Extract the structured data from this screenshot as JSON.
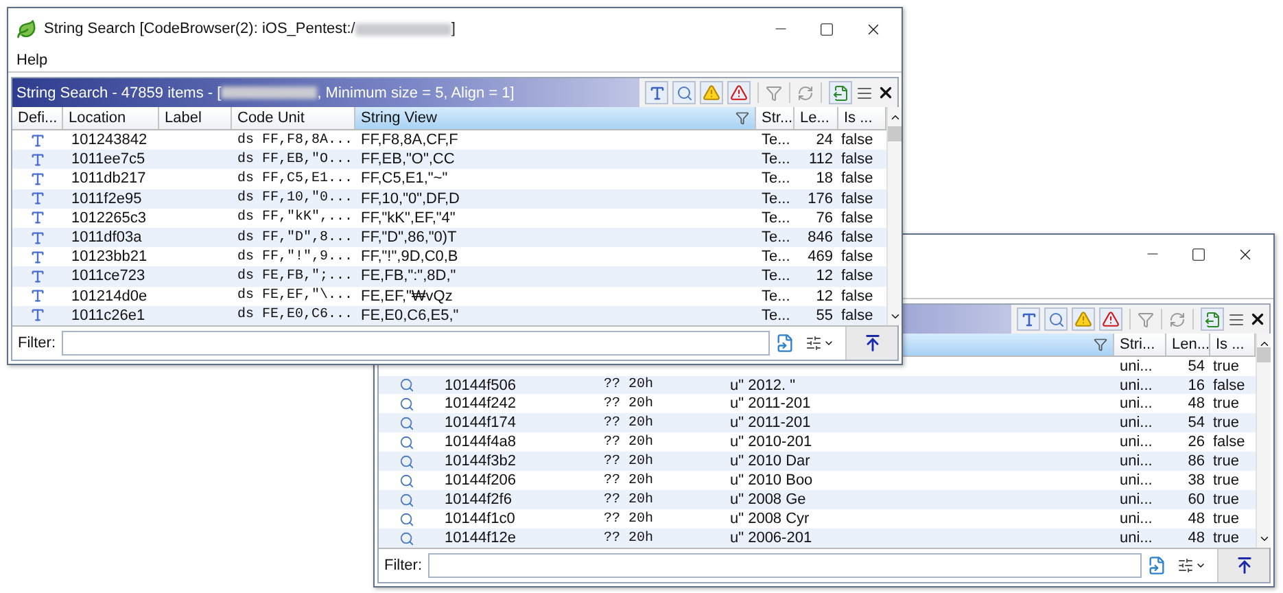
{
  "back_window": {
    "columns": [
      {
        "label": "Stri...",
        "selected": false
      },
      {
        "label": "Len...",
        "selected": false
      },
      {
        "label": "Is ...",
        "selected": false
      }
    ],
    "rows": [
      {
        "string_type": "uni...",
        "length": "54",
        "is_flag": "true"
      },
      {
        "location": "10144f506",
        "code_unit": "?? 20h",
        "string_view": "u\" 2012. \"",
        "string_type": "uni...",
        "length": "16",
        "is_flag": "false"
      },
      {
        "location": "10144f242",
        "code_unit": "?? 20h",
        "string_view": "u\" 2011-201",
        "string_type": "uni...",
        "length": "48",
        "is_flag": "true"
      },
      {
        "location": "10144f174",
        "code_unit": "?? 20h",
        "string_view": "u\" 2011-201",
        "string_type": "uni...",
        "length": "54",
        "is_flag": "true"
      },
      {
        "location": "10144f4a8",
        "code_unit": "?? 20h",
        "string_view": "u\" 2010-201",
        "string_type": "uni...",
        "length": "26",
        "is_flag": "false"
      },
      {
        "location": "10144f3b2",
        "code_unit": "?? 20h",
        "string_view": "u\" 2010 Dar",
        "string_type": "uni...",
        "length": "86",
        "is_flag": "true"
      },
      {
        "location": "10144f206",
        "code_unit": "?? 20h",
        "string_view": "u\" 2010 Boo",
        "string_type": "uni...",
        "length": "38",
        "is_flag": "true"
      },
      {
        "location": "10144f2f6",
        "code_unit": "?? 20h",
        "string_view": "u\" 2008 Ge",
        "string_type": "uni...",
        "length": "60",
        "is_flag": "true"
      },
      {
        "location": "10144f1c0",
        "code_unit": "?? 20h",
        "string_view": "u\" 2008 Cyr",
        "string_type": "uni...",
        "length": "48",
        "is_flag": "true"
      },
      {
        "location": "10144f12e",
        "code_unit": "?? 20h",
        "string_view": "u\" 2006-201",
        "string_type": "uni...",
        "length": "48",
        "is_flag": "true"
      }
    ],
    "filter_label": "Filter:"
  },
  "front_window": {
    "title_parts": [
      "String Search [CodeBrowser(2): iOS_Pentest:/",
      "]"
    ],
    "menu": [
      "Help"
    ],
    "panel_title_parts": [
      "String Search - 47859 items - [",
      ", Minimum size = 5, Align = 1]"
    ],
    "columns": [
      {
        "label": "Defi...",
        "selected": false
      },
      {
        "label": "Location",
        "selected": false
      },
      {
        "label": "Label",
        "selected": false
      },
      {
        "label": "Code Unit",
        "selected": false
      },
      {
        "label": "String View",
        "selected": true
      },
      {
        "label": "Str...",
        "selected": false
      },
      {
        "label": "Le...",
        "selected": false
      },
      {
        "label": "Is ...",
        "selected": false
      }
    ],
    "rows": [
      {
        "location": "101243842",
        "code_unit": "ds FF,F8,8A...",
        "string_view": "FF,F8,8A,CF,F",
        "string_type": "Te...",
        "length": "24",
        "is_flag": "false"
      },
      {
        "location": "1011ee7c5",
        "code_unit": "ds FF,EB,\"O...",
        "string_view": "FF,EB,\"O\",CC",
        "string_type": "Te...",
        "length": "112",
        "is_flag": "false"
      },
      {
        "location": "1011db217",
        "code_unit": "ds FF,C5,E1...",
        "string_view": "FF,C5,E1,\"~\"",
        "string_type": "Te...",
        "length": "18",
        "is_flag": "false"
      },
      {
        "location": "1011f2e95",
        "code_unit": "ds FF,10,\"0...",
        "string_view": "FF,10,\"0\",DF,D",
        "string_type": "Te...",
        "length": "176",
        "is_flag": "false"
      },
      {
        "location": "1012265c3",
        "code_unit": "ds FF,\"kK\",...",
        "string_view": "FF,\"kK\",EF,\"4\"",
        "string_type": "Te...",
        "length": "76",
        "is_flag": "false"
      },
      {
        "location": "1011df03a",
        "code_unit": "ds FF,\"D\",8...",
        "string_view": "FF,\"D\",86,\"0)T",
        "string_type": "Te...",
        "length": "846",
        "is_flag": "false"
      },
      {
        "location": "10123bb21",
        "code_unit": "ds FF,\"!\",9...",
        "string_view": "FF,\"!\",9D,C0,B",
        "string_type": "Te...",
        "length": "469",
        "is_flag": "false"
      },
      {
        "location": "1011ce723",
        "code_unit": "ds FE,FB,\";...",
        "string_view": "FE,FB,\":\",8D,\"",
        "string_type": "Te...",
        "length": "12",
        "is_flag": "false"
      },
      {
        "location": "101214d0e",
        "code_unit": "ds FE,EF,\"\\...",
        "string_view": "FE,EF,\"₩vQz",
        "string_type": "Te...",
        "length": "12",
        "is_flag": "false"
      },
      {
        "location": "1011c26e1",
        "code_unit": "ds FE,E0,C6...",
        "string_view": "FE,E0,C6,E5,\"",
        "string_type": "Te...",
        "length": "55",
        "is_flag": "false"
      }
    ],
    "filter_label": "Filter:"
  }
}
